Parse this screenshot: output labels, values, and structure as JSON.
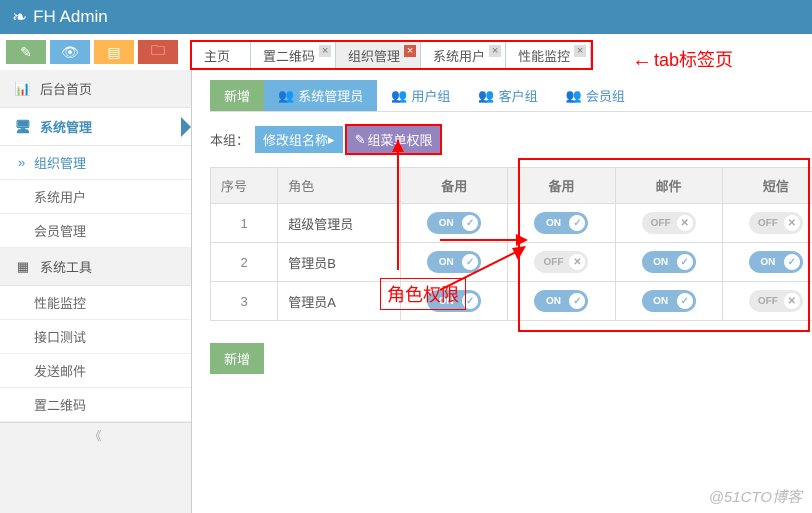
{
  "header": {
    "title": "FH Admin"
  },
  "tabs": [
    {
      "label": "主页",
      "closable": false
    },
    {
      "label": "置二维码",
      "closable": true
    },
    {
      "label": "组织管理",
      "closable": true,
      "active": true
    },
    {
      "label": "系统用户",
      "closable": true
    },
    {
      "label": "性能监控",
      "closable": true
    }
  ],
  "sidebar": {
    "home": "后台首页",
    "sys": "系统管理",
    "sys_items": [
      "组织管理",
      "系统用户",
      "会员管理"
    ],
    "tools": "系统工具",
    "tools_items": [
      "性能监控",
      "接口测试",
      "发送邮件",
      "置二维码"
    ]
  },
  "pills": {
    "new": "新增",
    "admin": "系统管理员",
    "usergrp": "用户组",
    "custgrp": "客户组",
    "memgrp": "会员组"
  },
  "group": {
    "label": "本组：",
    "rename": "修改组名称",
    "perm": "组菜单权限"
  },
  "columns": {
    "idx": "序号",
    "role": "角色",
    "c1": "备用",
    "c2": "备用",
    "c3": "邮件",
    "c4": "短信"
  },
  "rows": [
    {
      "n": "1",
      "role": "超级管理员",
      "t": [
        "on",
        "on",
        "off",
        "off"
      ]
    },
    {
      "n": "2",
      "role": "管理员B",
      "t": [
        "on",
        "off",
        "on",
        "on"
      ]
    },
    {
      "n": "3",
      "role": "管理员A",
      "t": [
        "on",
        "on",
        "on",
        "off"
      ]
    }
  ],
  "add": "新增",
  "anno": {
    "tabs": "tab标签页",
    "perm": "角色权限"
  },
  "watermark": "@51CTO博客",
  "toggle": {
    "on": "ON",
    "off": "OFF"
  }
}
